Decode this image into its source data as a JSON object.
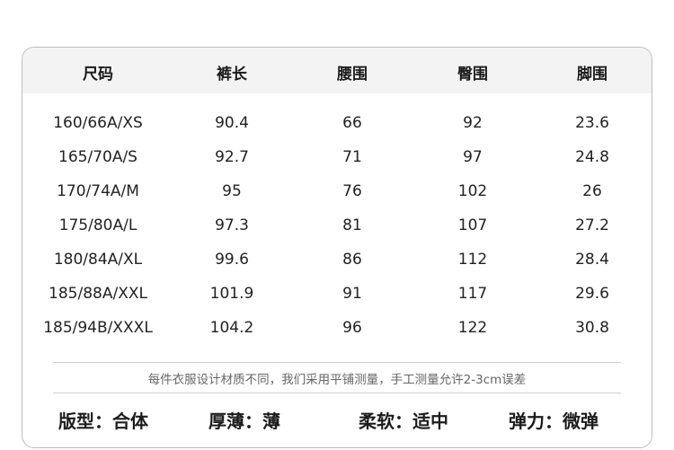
{
  "table": {
    "headers": [
      "尺码",
      "裤长",
      "腰围",
      "臀围",
      "脚围"
    ],
    "rows": [
      [
        "160/66A/XS",
        "90.4",
        "66",
        "92",
        "23.6"
      ],
      [
        "165/70A/S",
        "92.7",
        "71",
        "97",
        "24.8"
      ],
      [
        "170/74A/M",
        "95",
        "76",
        "102",
        "26"
      ],
      [
        "175/80A/L",
        "97.3",
        "81",
        "107",
        "27.2"
      ],
      [
        "180/84A/XL",
        "99.6",
        "86",
        "112",
        "28.4"
      ],
      [
        "185/88A/XXL",
        "101.9",
        "91",
        "117",
        "29.6"
      ],
      [
        "185/94B/XXXL",
        "104.2",
        "96",
        "122",
        "30.8"
      ]
    ]
  },
  "note": "每件衣服设计材质不同，我们采用平铺测量，手工测量允许2-3cm误差",
  "attributes": [
    "版型：合体",
    "厚薄：薄",
    "柔软：适中",
    "弹力：微弹"
  ]
}
